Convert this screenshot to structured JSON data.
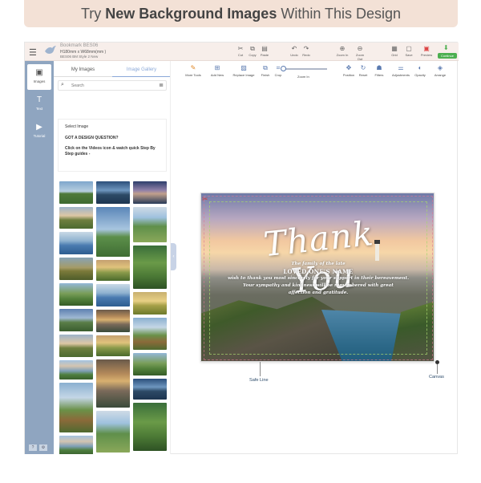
{
  "banner": {
    "pre": "Try",
    "bold": "New Background Images",
    "post": "Within This Design"
  },
  "topbar": {
    "doc_title": "Bookmark BES06",
    "doc_size": "H180mm x W68mm(mm )",
    "doc_style": "BES06 BM Style 2 New",
    "buttons": [
      "Cut",
      "Copy",
      "Paste",
      "Undo",
      "Redo",
      "Zoom In",
      "Zoom Out",
      "Grid",
      "Save",
      "Preview"
    ],
    "continue": "Continue"
  },
  "rail": {
    "items": [
      "Images",
      "Text",
      "Tutorial"
    ],
    "bottom": [
      "?",
      "⚙"
    ]
  },
  "panel": {
    "tabs": [
      "My Images",
      "Image Gallery"
    ],
    "search_placeholder": "Search",
    "select_image": "Select Image",
    "question": "GOT A DESIGN QUESTION?",
    "hint": "Click on the Videos icon & watch quick Step By Step guides -"
  },
  "toolbar2": {
    "buttons": [
      "More Tools",
      "Add New",
      "Replace Image",
      "Finish",
      "Crop",
      "Zoom In",
      "Position",
      "Reset",
      "Filters",
      "Adjustments",
      "Opacity",
      "Arrange"
    ]
  },
  "card": {
    "title": "Thank You",
    "line1": "The family of the late",
    "name": "LOVED ONE'S NAME",
    "line2": "wish to thank you most sincerely for your support in their bereavement.",
    "line3": "Your sympathy and kindness will be remembered with great",
    "line4": "affection and gratitude."
  },
  "labels": {
    "safe_line": "Safe Line",
    "canvas": "Canvas"
  },
  "icons": {
    "menu": "menu-icon",
    "cut": "scissors-icon",
    "undo": "undo-icon",
    "redo": "redo-icon",
    "zoom_in": "zoom-in-icon",
    "zoom_out": "zoom-out-icon",
    "search": "search-icon",
    "filter": "filter-icon"
  }
}
